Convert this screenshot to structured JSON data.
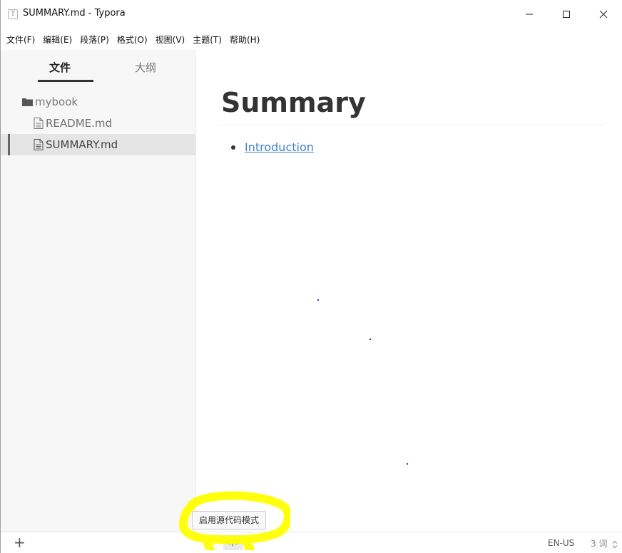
{
  "window": {
    "title": "SUMMARY.md - Typora",
    "app_icon_glyph": "T",
    "controls": [
      "minimize-icon",
      "maximize-icon",
      "close-icon"
    ]
  },
  "menu": {
    "items": [
      "文件(F)",
      "编辑(E)",
      "段落(P)",
      "格式(O)",
      "视图(V)",
      "主题(T)",
      "帮助(H)"
    ]
  },
  "sidebar": {
    "tabs": {
      "files": "文件",
      "outline": "大纲"
    },
    "tree": {
      "folder": "mybook",
      "files": [
        "README.md",
        "SUMMARY.md"
      ],
      "selected": "SUMMARY.md"
    }
  },
  "document": {
    "heading": "Summary",
    "list": [
      "Introduction"
    ]
  },
  "statusbar": {
    "add": "+",
    "back": "‹",
    "source": "</>",
    "language": "EN-US",
    "word_count": "3 词",
    "sort_icon": "sort-icon"
  },
  "tooltip": {
    "text": "启用源代码模式"
  },
  "colors": {
    "link": "#4183c4",
    "sidebar_bg": "#f7f7f7",
    "highlight": "#ffff00",
    "stray_dots": "#3b3bd0"
  }
}
